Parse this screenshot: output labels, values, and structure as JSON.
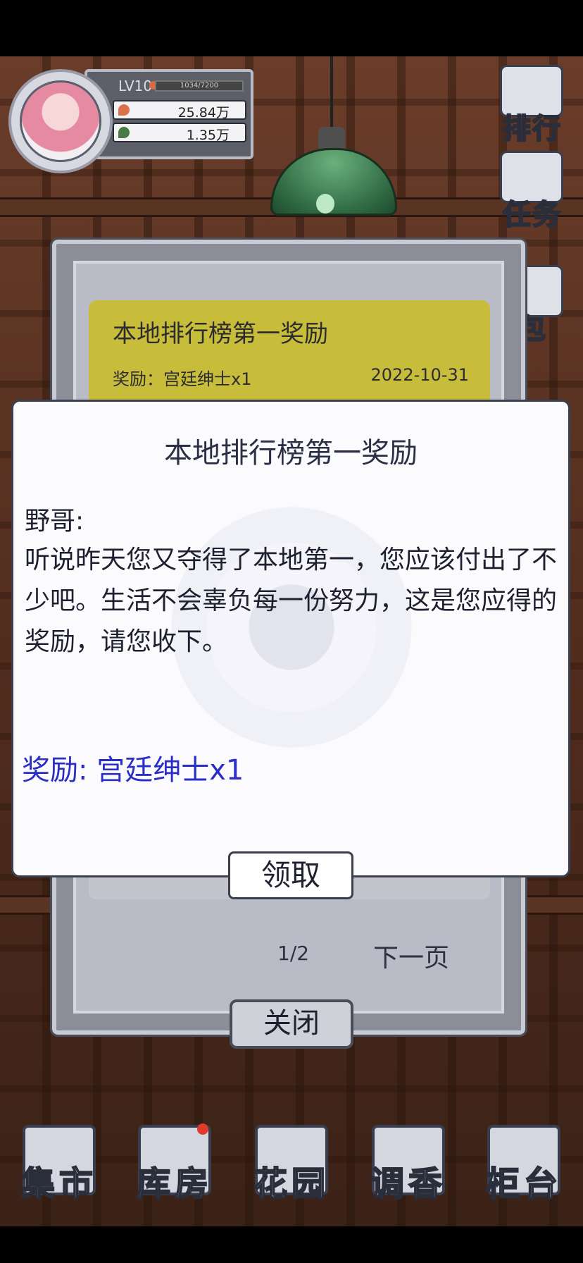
{
  "player": {
    "level": "LV10",
    "xp": "1034/7200",
    "coins": "25.84万",
    "leaves": "1.35万"
  },
  "side_menu": {
    "ranking": "排行",
    "tasks": "任务",
    "bag": "包"
  },
  "mail_list": {
    "item_title": "本地排行榜第一奖励",
    "item_reward": "奖励：宫廷绅士x1",
    "item_date": "2022-10-31",
    "page": "1/2",
    "next_page": "下一页",
    "close": "关闭"
  },
  "dialog": {
    "title": "本地排行榜第一奖励",
    "greeting": "野哥:",
    "body": "听说昨天您又夺得了本地第一，您应该付出了不少吧。生活不会辜负每一份努力，这是您应得的奖励，请您收下。",
    "reward": "奖励: 宫廷绅士x1",
    "claim": "领取"
  },
  "bottom_nav": [
    {
      "label": "集市",
      "icon": "market-icon"
    },
    {
      "label": "库房",
      "icon": "warehouse-icon"
    },
    {
      "label": "花园",
      "icon": "garden-icon"
    },
    {
      "label": "调香",
      "icon": "perfume-icon"
    },
    {
      "label": "柜台",
      "icon": "counter-icon"
    }
  ],
  "colors": {
    "dialog_title": "#2b2f45",
    "reward_text": "#2a2ec4",
    "mail_card": "#c8bd3a"
  }
}
